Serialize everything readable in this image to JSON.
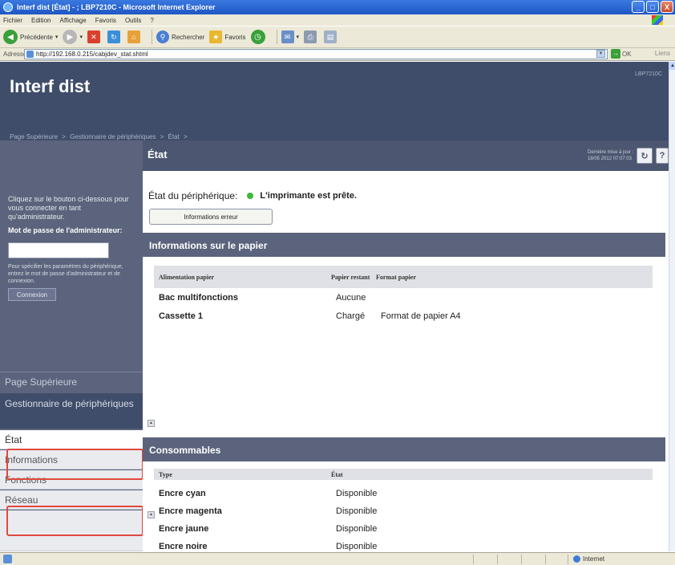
{
  "window": {
    "title": "Interf dist [État] - ; LBP7210C - Microsoft Internet Explorer",
    "controls": [
      "_",
      "□",
      "X"
    ]
  },
  "menubar": {
    "items": [
      "Fichier",
      "Edition",
      "Affichage",
      "Favoris",
      "Outils",
      "?"
    ]
  },
  "toolbar": {
    "back_label": "Précédente",
    "search_label": "Rechercher",
    "favorites_label": "Favoris"
  },
  "addressbar": {
    "label": "Adresse",
    "url": "http://192.168.0.215/cabjdev_stat.shtml",
    "go_label": "OK",
    "links_label": "Liens"
  },
  "header": {
    "app_title": "Interf dist",
    "device_model": "LBP7210C"
  },
  "breadcrumb": {
    "items": [
      "Page Supérieure",
      "Gestionnaire de périphériques",
      "État"
    ],
    "separator": ">"
  },
  "page": {
    "title": "État",
    "last_update_line1": "Dernière mise à jour :",
    "last_update_line2": "18/05 2012 07:07:03",
    "refresh_icon": "↻",
    "help_icon": "?"
  },
  "sidebar": {
    "login_text": "Cliquez sur le bouton ci-dessous pour vous connecter en tant qu'administrateur.",
    "password_label": "Mot de passe de l'administrateur:",
    "hint_text": "Pour spécifier les paramètres du périphérique, entrez le mot de passe d'administrateur et de connexion.",
    "login_button": "Connexion",
    "nav_top": "Page Supérieure",
    "nav_section": "Gestionnaire de périphériques",
    "nav_items": [
      "État",
      "Informations",
      "Fonctions",
      "Réseau"
    ]
  },
  "main": {
    "status_label": "État du périphérique:",
    "status_value": "L'imprimante est prête.",
    "status_color": "#3ab83a",
    "error_button": "Informations erreur",
    "paper_section": "Informations sur le papier",
    "paper_headers": [
      "Alimentation papier",
      "Papier restant",
      "Format papier"
    ],
    "paper_rows": [
      {
        "source": "Bac multifonctions",
        "remaining": "Aucune",
        "format": ""
      },
      {
        "source": "Cassette 1",
        "remaining": "Chargé",
        "format": "Format de papier A4"
      }
    ],
    "consumables_section": "Consommables",
    "consumables_headers": [
      "Type",
      "État"
    ],
    "consumables_rows": [
      {
        "type": "Encre cyan",
        "state": "Disponible"
      },
      {
        "type": "Encre magenta",
        "state": "Disponible"
      },
      {
        "type": "Encre jaune",
        "state": "Disponible"
      },
      {
        "type": "Encre noire",
        "state": "Disponible"
      }
    ],
    "up_icon": "▲"
  },
  "statusbar": {
    "zone": "Internet"
  },
  "colors": {
    "header_bg": "#3f4d6a",
    "sidebar_bg": "#5b647c",
    "highlight": "#e0483e"
  }
}
